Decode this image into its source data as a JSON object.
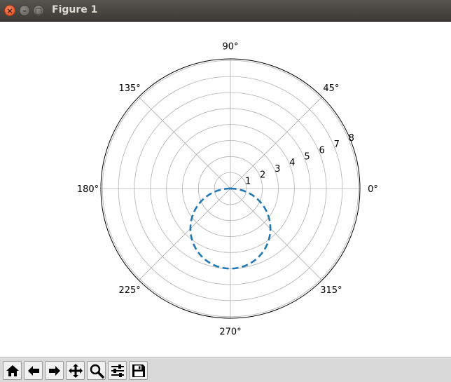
{
  "window": {
    "title": "Figure 1",
    "close_glyph": "×",
    "minimize_glyph": "–",
    "maximize_glyph": "□"
  },
  "toolbar": {
    "buttons": [
      {
        "icon": "home-icon"
      },
      {
        "icon": "back-arrow-icon"
      },
      {
        "icon": "forward-arrow-icon"
      },
      {
        "icon": "pan-icon"
      },
      {
        "icon": "zoom-icon"
      },
      {
        "icon": "configure-subplots-icon"
      },
      {
        "icon": "save-icon"
      }
    ]
  },
  "chart_data": {
    "type": "polar-line",
    "theta_tick_labels": [
      "0°",
      "45°",
      "90°",
      "135°",
      "180°",
      "225°",
      "270°",
      "315°"
    ],
    "r_tick_labels": [
      "1",
      "2",
      "3",
      "4",
      "5",
      "6",
      "7",
      "8"
    ],
    "rlim": [
      0,
      8.1
    ],
    "r_label_angle_deg": 22.5,
    "grid": true,
    "series": [
      {
        "style": "dashed",
        "color": "#1f77b4",
        "equation": "r = -5·sin(θ)",
        "curve": "circle of diameter 5 centered at (r=2.5, θ=270°), passing through the origin",
        "r_max": 5,
        "r_max_theta_deg": 270
      }
    ]
  }
}
